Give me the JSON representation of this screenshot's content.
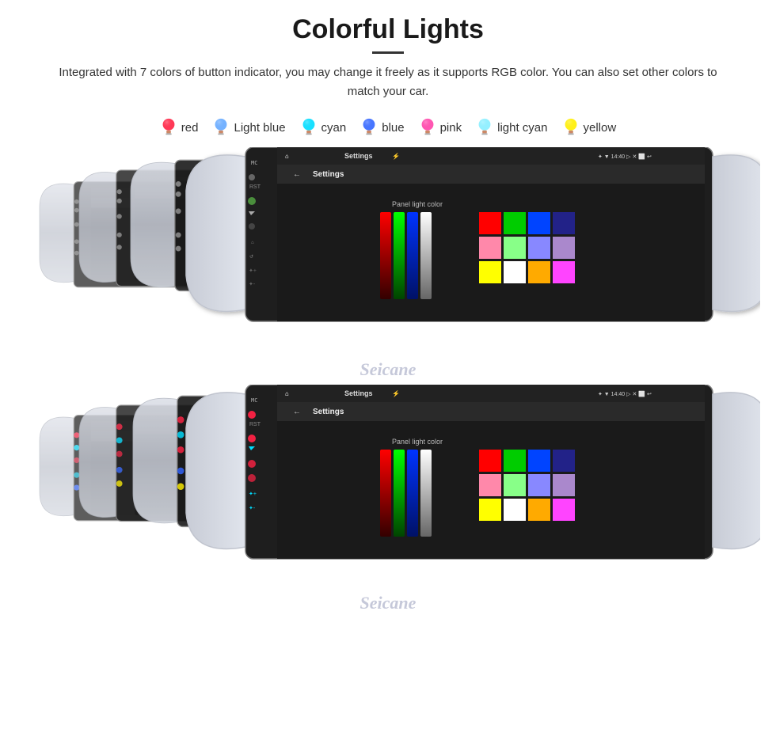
{
  "header": {
    "title": "Colorful Lights",
    "description": "Integrated with 7 colors of button indicator, you may change it freely as it supports RGB color. You can also set other colors to match your car.",
    "divider": true
  },
  "colors": [
    {
      "name": "red",
      "hex": "#ff2244",
      "bulb_color": "#ff2244"
    },
    {
      "name": "Light blue",
      "hex": "#66aaff",
      "bulb_color": "#66aaff"
    },
    {
      "name": "cyan",
      "hex": "#00ddff",
      "bulb_color": "#00ddff"
    },
    {
      "name": "blue",
      "hex": "#3366ff",
      "bulb_color": "#3366ff"
    },
    {
      "name": "pink",
      "hex": "#ff44aa",
      "bulb_color": "#ff44aa"
    },
    {
      "name": "light cyan",
      "hex": "#88eeff",
      "bulb_color": "#88eeff"
    },
    {
      "name": "yellow",
      "hex": "#ffee00",
      "bulb_color": "#ffee00"
    }
  ],
  "screen": {
    "statusbar_left": "⌂  ✦  Settings  ⚡",
    "statusbar_right": "✦  ▼  14:40  ▷  ✕  ⬜  ↩",
    "settings_title": "Settings",
    "palette_label": "Panel light color",
    "back_arrow": "←"
  },
  "watermark": "Seicane",
  "sections": [
    {
      "id": "top",
      "lit_colors": [
        "#ffffff",
        "#ffffff",
        "#ffffff",
        "#ffffff"
      ]
    },
    {
      "id": "bottom",
      "lit_colors": [
        "#ff2244",
        "#00ddff",
        "#66aaff",
        "#3366ff",
        "#ffee00"
      ]
    }
  ]
}
